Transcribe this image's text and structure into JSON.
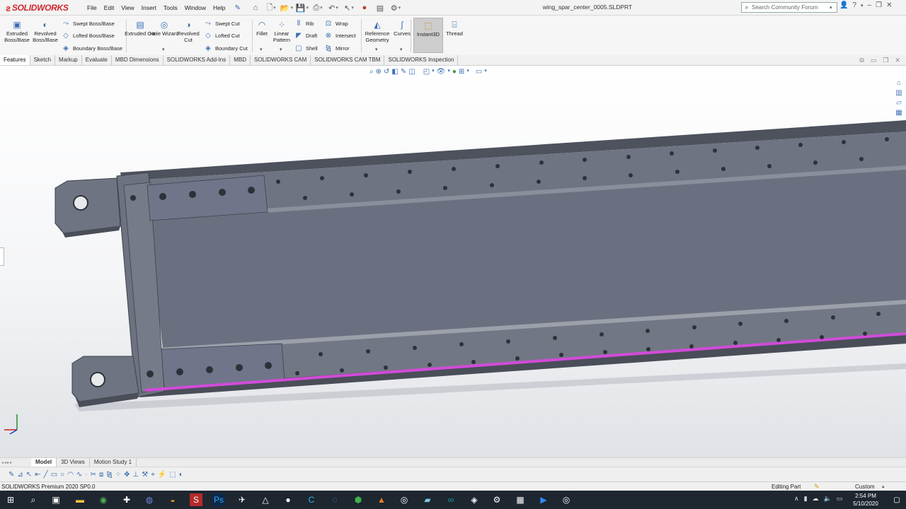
{
  "app": {
    "brand": "SOLIDWORKS",
    "document_title": "wing_spar_center_0005.SLDPRT"
  },
  "menu": [
    "File",
    "Edit",
    "View",
    "Insert",
    "Tools",
    "Window",
    "Help"
  ],
  "search": {
    "placeholder": "Search Community Forum"
  },
  "command_manager": {
    "large": [
      {
        "label": "Extruded Boss/Base",
        "icon": "extruded-boss-icon"
      },
      {
        "label": "Revolved Boss/Base",
        "icon": "revolved-boss-icon"
      },
      {
        "label": "Extruded Cut",
        "icon": "extruded-cut-icon"
      },
      {
        "label": "Hole Wizard",
        "icon": "hole-wizard-icon"
      },
      {
        "label": "Revolved Cut",
        "icon": "revolved-cut-icon"
      },
      {
        "label": "Fillet",
        "icon": "fillet-icon"
      },
      {
        "label": "Linear Pattern",
        "icon": "linear-pattern-icon"
      },
      {
        "label": "Reference Geometry",
        "icon": "reference-geometry-icon"
      },
      {
        "label": "Curves",
        "icon": "curves-icon"
      },
      {
        "label": "Instant3D",
        "icon": "instant3d-icon"
      },
      {
        "label": "Thread",
        "icon": "thread-icon"
      }
    ],
    "small": [
      {
        "label": "Swept Boss/Base",
        "icon": "swept-boss-icon"
      },
      {
        "label": "Lofted Boss/Base",
        "icon": "lofted-boss-icon"
      },
      {
        "label": "Boundary Boss/Base",
        "icon": "boundary-boss-icon"
      },
      {
        "label": "Swept Cut",
        "icon": "swept-cut-icon"
      },
      {
        "label": "Lofted Cut",
        "icon": "lofted-cut-icon"
      },
      {
        "label": "Boundary Cut",
        "icon": "boundary-cut-icon"
      },
      {
        "label": "Rib",
        "icon": "rib-icon"
      },
      {
        "label": "Draft",
        "icon": "draft-icon"
      },
      {
        "label": "Shell",
        "icon": "shell-icon"
      },
      {
        "label": "Wrap",
        "icon": "wrap-icon"
      },
      {
        "label": "Intersect",
        "icon": "intersect-icon"
      },
      {
        "label": "Mirror",
        "icon": "mirror-icon"
      }
    ]
  },
  "tabs": [
    "Features",
    "Sketch",
    "Markup",
    "Evaluate",
    "MBD Dimensions",
    "SOLIDWORKS Add-Ins",
    "MBD",
    "SOLIDWORKS CAM",
    "SOLIDWORKS CAM TBM",
    "SOLIDWORKS Inspection"
  ],
  "model_tabs": [
    "Model",
    "3D Views",
    "Motion Study 1"
  ],
  "status": {
    "product": "SOLIDWORKS Premium 2020 SP0.0",
    "mode": "Editing Part",
    "units": "Custom"
  },
  "taskbar": {
    "time": "2:54 PM",
    "date": "5/10/2020"
  },
  "colors": {
    "model_face": "#6f7483",
    "model_dark": "#4a4e58",
    "selected_edge": "#d14bd9",
    "brand_red": "#d0262d",
    "taskbar": "#1e2630"
  }
}
